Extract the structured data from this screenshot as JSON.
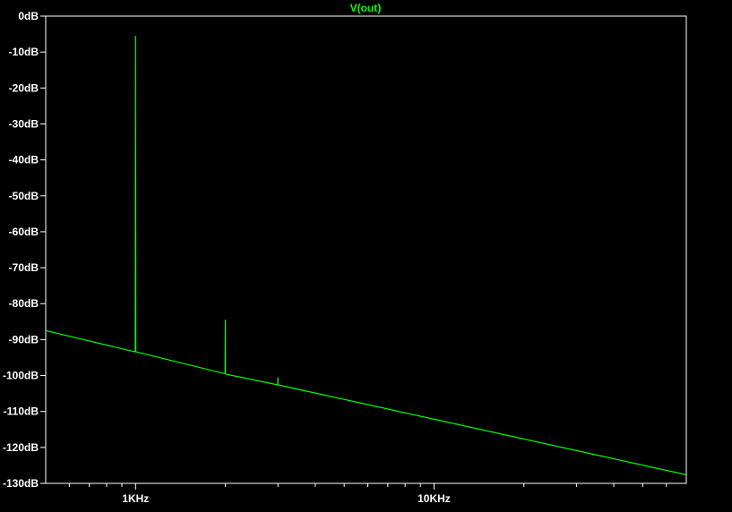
{
  "chart_data": {
    "type": "line",
    "title": "",
    "xlabel": "",
    "ylabel": "",
    "x_scale": "log",
    "xlim": [
      500,
      70000
    ],
    "ylim": [
      -130,
      0
    ],
    "grid": false,
    "background": "#000000",
    "axis_color": "#ffffff",
    "series": [
      {
        "name": "V(out)",
        "color": "#00ff00",
        "x": [
          500,
          995,
          998,
          999,
          1000,
          1000,
          1001,
          1002,
          1005,
          1995,
          2000,
          2000,
          2005,
          2995,
          3000,
          3000,
          3005,
          70000
        ],
        "y": [
          -87.5,
          -93.4,
          -93.4,
          -71,
          -5.5,
          -27,
          -50,
          -93.4,
          -93.4,
          -99.5,
          -84.5,
          -99.5,
          -99.6,
          -102.6,
          -100.5,
          -102.6,
          -102.6,
          -127.6
        ]
      }
    ],
    "y_ticks": [
      "0dB",
      "-10dB",
      "-20dB",
      "-30dB",
      "-40dB",
      "-50dB",
      "-60dB",
      "-70dB",
      "-80dB",
      "-90dB",
      "-100dB",
      "-110dB",
      "-120dB",
      "-130dB"
    ],
    "y_tick_values": [
      0,
      -10,
      -20,
      -30,
      -40,
      -50,
      -60,
      -70,
      -80,
      -90,
      -100,
      -110,
      -120,
      -130
    ],
    "x_ticks": [
      "1KHz",
      "10KHz"
    ],
    "x_tick_values": [
      1000,
      10000
    ],
    "x_minor_tick_values": [
      600,
      700,
      800,
      900,
      2000,
      3000,
      4000,
      5000,
      6000,
      7000,
      8000,
      9000,
      20000,
      30000,
      40000,
      50000,
      60000
    ]
  }
}
